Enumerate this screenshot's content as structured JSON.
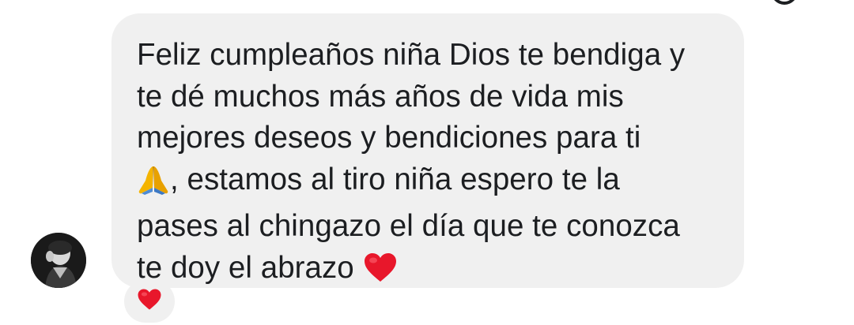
{
  "message": {
    "lines": [
      "Feliz cumpleaños niña Dios te bendiga y",
      "te dé muchos más años de vida mis",
      "mejores deseos y bendiciones para ti",
      ", estamos al tiro niña espero te la",
      "pases al chingazo el día que te conozca",
      "te doy el abrazo"
    ],
    "inline_emojis": [
      "praying-hands-emoji",
      "red-heart-emoji"
    ]
  },
  "reaction": {
    "emoji": "red-heart-emoji"
  },
  "colors": {
    "bubble": "#f0f0f0",
    "text": "#1c1e21",
    "heart": "#e8172b",
    "hands": "#f4b400"
  }
}
